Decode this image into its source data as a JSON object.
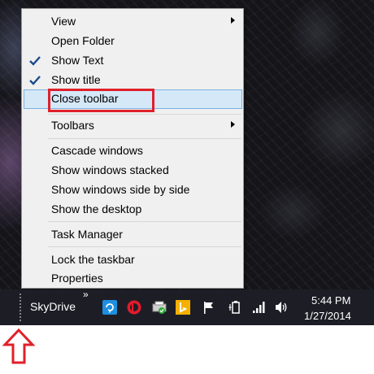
{
  "menu": {
    "items": [
      {
        "label": "View",
        "submenu": true,
        "checked": false
      },
      {
        "label": "Open Folder",
        "submenu": false,
        "checked": false
      },
      {
        "label": "Show Text",
        "submenu": false,
        "checked": true
      },
      {
        "label": "Show title",
        "submenu": false,
        "checked": true
      },
      {
        "label": "Close toolbar",
        "submenu": false,
        "checked": false,
        "highlighted": true
      },
      {
        "label": "Toolbars",
        "submenu": true,
        "checked": false
      },
      {
        "label": "Cascade windows",
        "submenu": false,
        "checked": false
      },
      {
        "label": "Show windows stacked",
        "submenu": false,
        "checked": false
      },
      {
        "label": "Show windows side by side",
        "submenu": false,
        "checked": false
      },
      {
        "label": "Show the desktop",
        "submenu": false,
        "checked": false
      },
      {
        "label": "Task Manager",
        "submenu": false,
        "checked": false
      },
      {
        "label": "Lock the taskbar",
        "submenu": false,
        "checked": false
      },
      {
        "label": "Properties",
        "submenu": false,
        "checked": false
      }
    ]
  },
  "taskbar": {
    "toolbar_label": "SkyDrive",
    "overflow_glyph": "»",
    "tray_icons": [
      "skydrive-sync-icon",
      "beats-audio-icon",
      "printer-status-icon",
      "bing-icon",
      "action-center-flag-icon",
      "power-plug-icon",
      "signal-bars-icon",
      "speaker-volume-icon"
    ],
    "time": "5:44 PM",
    "date": "1/27/2014"
  },
  "colors": {
    "highlight_fill": "#d5e8f8",
    "highlight_border": "#7db2e1",
    "annotation_red": "#e0202a",
    "taskbar_bg": "#1d1d26"
  }
}
